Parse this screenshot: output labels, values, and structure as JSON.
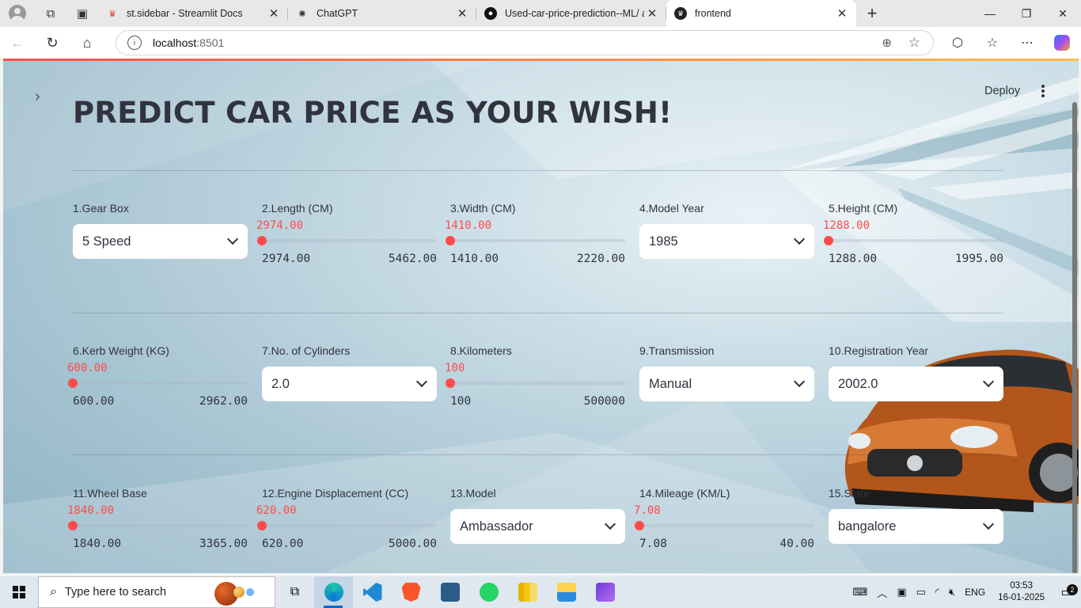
{
  "browser": {
    "tabs": [
      {
        "title": "st.sidebar - Streamlit Docs",
        "icon": "streamlit-crown-icon"
      },
      {
        "title": "ChatGPT",
        "icon": "chatgpt-icon"
      },
      {
        "title": "Used-car-price-prediction--ML/ a",
        "icon": "github-icon"
      },
      {
        "title": "frontend",
        "icon": "streamlit-crown-icon"
      }
    ],
    "url_host": "localhost",
    "url_port": ":8501"
  },
  "app": {
    "title": "PREDICT CAR PRICE AS YOUR WISH!",
    "deploy_label": "Deploy",
    "accent_color": "#ff4b4b",
    "widgets": {
      "gear_box": {
        "label": "1.Gear Box",
        "value": "5 Speed"
      },
      "length": {
        "label": "2.Length (CM)",
        "value": "2974.00",
        "min": "2974.00",
        "max": "5462.00"
      },
      "width": {
        "label": "3.Width (CM)",
        "value": "1410.00",
        "min": "1410.00",
        "max": "2220.00"
      },
      "model_year": {
        "label": "4.Model Year",
        "value": "1985"
      },
      "height": {
        "label": "5.Height (CM)",
        "value": "1288.00",
        "min": "1288.00",
        "max": "1995.00"
      },
      "kerb_weight": {
        "label": "6.Kerb Weight (KG)",
        "value": "600.00",
        "min": "600.00",
        "max": "2962.00"
      },
      "cylinders": {
        "label": "7.No. of Cylinders",
        "value": "2.0"
      },
      "kilometers": {
        "label": "8.Kilometers",
        "value": "100",
        "min": "100",
        "max": "500000"
      },
      "transmission": {
        "label": "9.Transmission",
        "value": "Manual"
      },
      "registration_year": {
        "label": "10.Registration Year",
        "value": "2002.0"
      },
      "wheel_base": {
        "label": "11.Wheel Base",
        "value": "1840.00",
        "min": "1840.00",
        "max": "3365.00"
      },
      "engine_displacement": {
        "label": "12.Engine Displacement (CC)",
        "value": "620.00",
        "min": "620.00",
        "max": "5000.00"
      },
      "model": {
        "label": "13.Model",
        "value": "Ambassador"
      },
      "mileage": {
        "label": "14.Mileage (KM/L)",
        "value": "7.08",
        "min": "7.08",
        "max": "40.00"
      },
      "state": {
        "label": "15.State",
        "value": "bangalore"
      }
    }
  },
  "taskbar": {
    "search_placeholder": "Type here to search",
    "language": "ENG",
    "time": "03:53",
    "date": "16-01-2025",
    "notification_count": "2"
  }
}
